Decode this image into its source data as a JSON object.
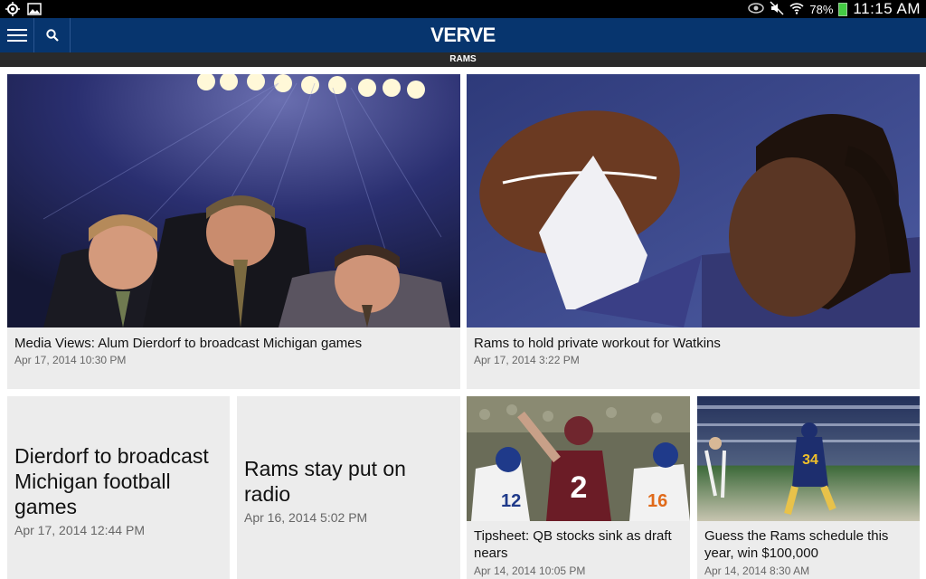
{
  "status": {
    "battery": "78%",
    "time": "11:15 AM"
  },
  "header": {
    "logo": "VERVE",
    "section": "RAMS"
  },
  "articles": [
    {
      "title": "Media Views: Alum Dierdorf to broadcast Michigan games",
      "date": "Apr 17, 2014 10:30 PM"
    },
    {
      "title": "Rams to hold private workout for Watkins",
      "date": "Apr 17, 2014 3:22 PM"
    },
    {
      "title": "Dierdorf to broadcast Michigan football games",
      "date": "Apr 17, 2014 12:44 PM"
    },
    {
      "title": "Rams stay put on radio",
      "date": "Apr 16, 2014 5:02 PM"
    },
    {
      "title": "Tipsheet: QB stocks sink as draft nears",
      "date": "Apr 14, 2014 10:05 PM"
    },
    {
      "title": "Guess the Rams schedule this year, win $100,000",
      "date": "Apr 14, 2014 8:30 AM"
    }
  ],
  "colors": {
    "appbar": "#07356e",
    "card": "#ececec"
  }
}
